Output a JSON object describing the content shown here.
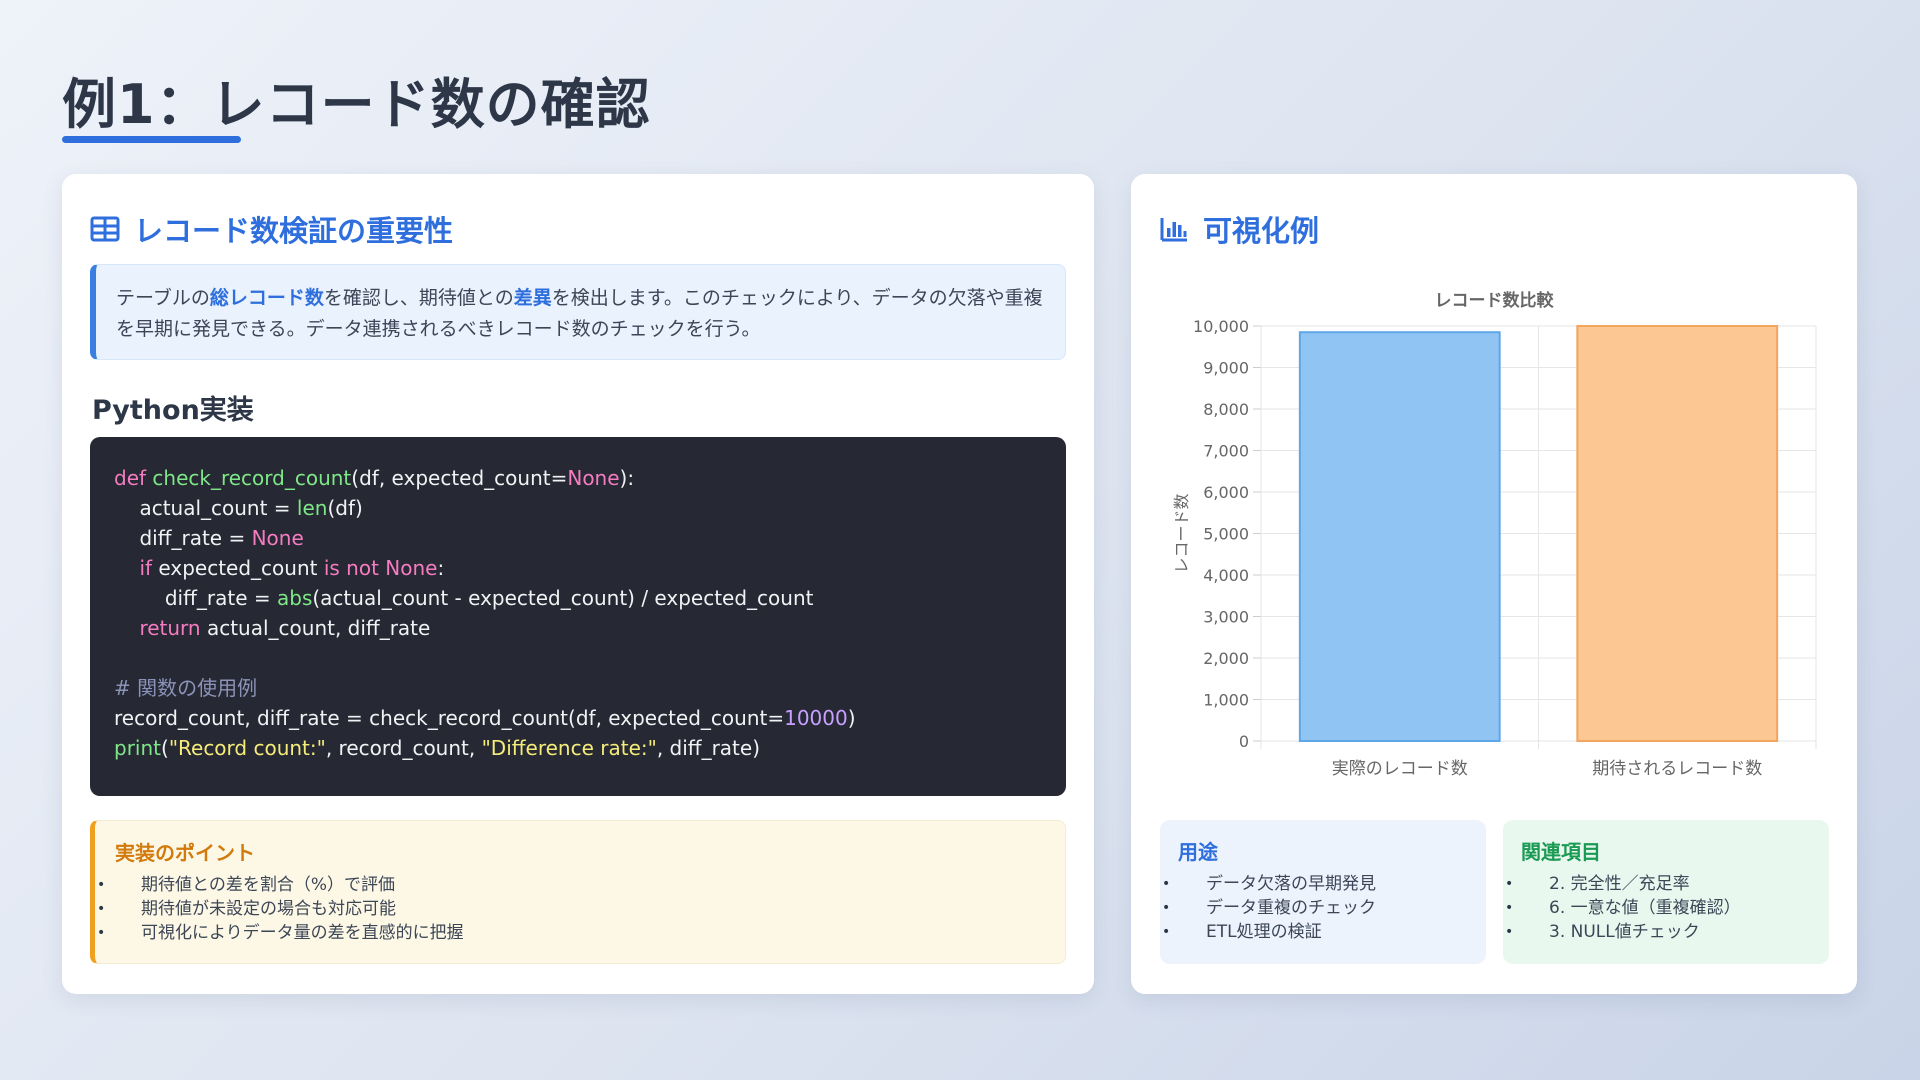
{
  "page": {
    "title": "例1：レコード数の確認"
  },
  "left_card": {
    "header": "レコード数検証の重要性",
    "icon": "table-icon",
    "description": {
      "part1": "テーブルの",
      "hl1": "総レコード数",
      "part2": "を確認し、期待値との",
      "hl2": "差異",
      "part3": "を検出します。このチェックにより、データの欠落や重複を早期に発見できる。データ連携されるべきレコード数のチェックを行う。"
    },
    "code_title": "Python実装",
    "code": {
      "l1": {
        "kw_def": "def",
        "fn_name": "check_record_count",
        "args": "(df, expected_count=",
        "none": "None",
        "end": "):"
      },
      "l2": {
        "indent": "    ",
        "text": "actual_count = ",
        "fn": "len",
        "end": "(df)"
      },
      "l3": {
        "indent": "    ",
        "text": "diff_rate = ",
        "none": "None"
      },
      "l4": {
        "indent": "    ",
        "kw_if": "if",
        "text": " expected_count ",
        "kw_isnot": "is not",
        "none": " None",
        "end": ":"
      },
      "l5": {
        "indent": "        ",
        "text": "diff_rate = ",
        "fn": "abs",
        "end": "(actual_count - expected_count) / expected_count"
      },
      "l6": {
        "indent": "    ",
        "kw_return": "return",
        "end": " actual_count, diff_rate"
      },
      "l8": {
        "comment": "# 関数の使用例"
      },
      "l9": {
        "text": "record_count, diff_rate = check_record_count(df, expected_count=",
        "num": "10000",
        "end": ")"
      },
      "l10": {
        "fn": "print",
        "open": "(",
        "str1": "\"Record count:\"",
        "mid": ", record_count, ",
        "str2": "\"Difference rate:\"",
        "end": ", diff_rate)"
      }
    },
    "points": {
      "title": "実装のポイント",
      "items": [
        "期待値との差を割合（%）で評価",
        "期待値が未設定の場合も対応可能",
        "可視化によりデータ量の差を直感的に把握"
      ]
    }
  },
  "right_card": {
    "header": "可視化例",
    "icon": "bar-chart-icon",
    "usage": {
      "title": "用途",
      "items": [
        "データ欠落の早期発見",
        "データ重複のチェック",
        "ETL処理の検証"
      ]
    },
    "related": {
      "title": "関連項目",
      "items": [
        "2. 完全性／充足率",
        "6. 一意な値（重複確認）",
        "3. NULL値チェック"
      ]
    }
  },
  "chart_data": {
    "type": "bar",
    "title": "レコード数比較",
    "xlabel": "",
    "ylabel": "レコード数",
    "categories": [
      "実際のレコード数",
      "期待されるレコード数"
    ],
    "values": [
      9850,
      10000
    ],
    "ylim": [
      0,
      10000
    ],
    "yticks": [
      0,
      1000,
      2000,
      3000,
      4000,
      5000,
      6000,
      7000,
      8000,
      9000,
      10000
    ],
    "ytick_labels": [
      "0",
      "1,000",
      "2,000",
      "3,000",
      "4,000",
      "5,000",
      "6,000",
      "7,000",
      "8,000",
      "9,000",
      "10,000"
    ],
    "colors": [
      {
        "fill": "#90c5f3",
        "stroke": "#5fa6e8"
      },
      {
        "fill": "#fcc793",
        "stroke": "#f2a55e"
      }
    ],
    "grid": true,
    "legend": "none"
  }
}
